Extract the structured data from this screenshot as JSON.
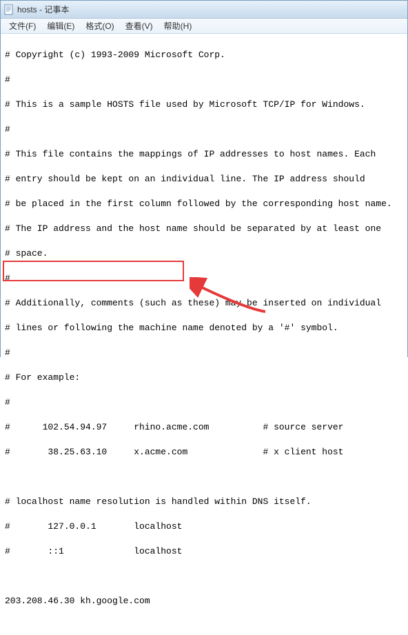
{
  "titlebar": {
    "title": "hosts - 记事本"
  },
  "menubar": {
    "file": "文件(F)",
    "edit": "编辑(E)",
    "format": "格式(O)",
    "view": "查看(V)",
    "help": "帮助(H)"
  },
  "content": {
    "lines": [
      "# Copyright (c) 1993-2009 Microsoft Corp.",
      "#",
      "# This is a sample HOSTS file used by Microsoft TCP/IP for Windows.",
      "#",
      "# This file contains the mappings of IP addresses to host names. Each",
      "# entry should be kept on an individual line. The IP address should",
      "# be placed in the first column followed by the corresponding host name.",
      "# The IP address and the host name should be separated by at least one",
      "# space.",
      "#",
      "# Additionally, comments (such as these) may be inserted on individual",
      "# lines or following the machine name denoted by a '#' symbol.",
      "#",
      "# For example:",
      "#",
      "#      102.54.94.97     rhino.acme.com          # source server",
      "#       38.25.63.10     x.acme.com              # x client host",
      "",
      "# localhost name resolution is handled within DNS itself.",
      "#       127.0.0.1       localhost",
      "#       ::1             localhost",
      "",
      "203.208.46.30 kh.google.com"
    ]
  },
  "annotation": {
    "highlighted_entry": "203.208.46.30 kh.google.com",
    "box_color": "#e63939",
    "arrow_color": "#e63939"
  }
}
